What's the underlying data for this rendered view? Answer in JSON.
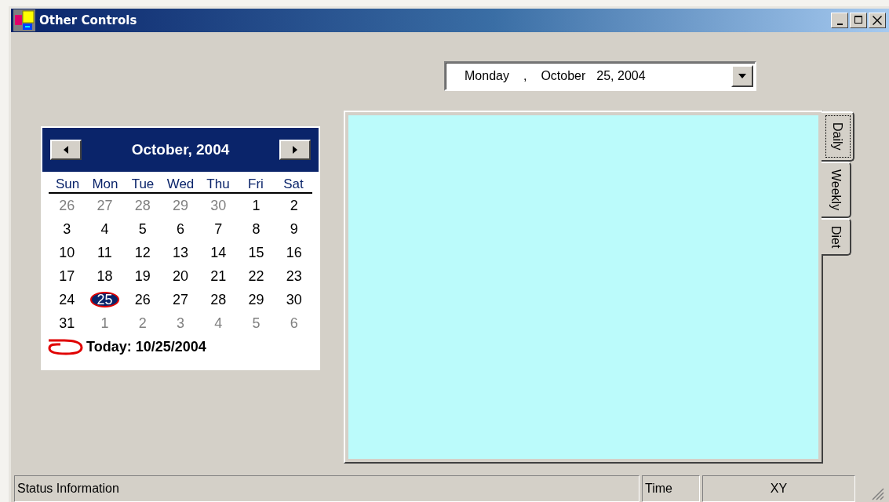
{
  "window": {
    "title": "Other Controls",
    "buttons": [
      {
        "kind": "minimize"
      },
      {
        "kind": "maximize"
      },
      {
        "kind": "close"
      }
    ]
  },
  "date_picker": {
    "segments": [
      "Monday",
      ",",
      "October",
      "25, 2004"
    ]
  },
  "calendar": {
    "title": "October, 2004",
    "weekdays": [
      "Sun",
      "Mon",
      "Tue",
      "Wed",
      "Thu",
      "Fri",
      "Sat"
    ],
    "weeks": [
      [
        {
          "text": "26",
          "other_month": true,
          "selected": false,
          "today": false
        },
        {
          "text": "27",
          "other_month": true,
          "selected": false,
          "today": false
        },
        {
          "text": "28",
          "other_month": true,
          "selected": false,
          "today": false
        },
        {
          "text": "29",
          "other_month": true,
          "selected": false,
          "today": false
        },
        {
          "text": "30",
          "other_month": true,
          "selected": false,
          "today": false
        },
        {
          "text": "1",
          "other_month": false,
          "selected": false,
          "today": false
        },
        {
          "text": "2",
          "other_month": false,
          "selected": false,
          "today": false
        }
      ],
      [
        {
          "text": "3",
          "other_month": false,
          "selected": false,
          "today": false
        },
        {
          "text": "4",
          "other_month": false,
          "selected": false,
          "today": false
        },
        {
          "text": "5",
          "other_month": false,
          "selected": false,
          "today": false
        },
        {
          "text": "6",
          "other_month": false,
          "selected": false,
          "today": false
        },
        {
          "text": "7",
          "other_month": false,
          "selected": false,
          "today": false
        },
        {
          "text": "8",
          "other_month": false,
          "selected": false,
          "today": false
        },
        {
          "text": "9",
          "other_month": false,
          "selected": false,
          "today": false
        }
      ],
      [
        {
          "text": "10",
          "other_month": false,
          "selected": false,
          "today": false
        },
        {
          "text": "11",
          "other_month": false,
          "selected": false,
          "today": false
        },
        {
          "text": "12",
          "other_month": false,
          "selected": false,
          "today": false
        },
        {
          "text": "13",
          "other_month": false,
          "selected": false,
          "today": false
        },
        {
          "text": "14",
          "other_month": false,
          "selected": false,
          "today": false
        },
        {
          "text": "15",
          "other_month": false,
          "selected": false,
          "today": false
        },
        {
          "text": "16",
          "other_month": false,
          "selected": false,
          "today": false
        }
      ],
      [
        {
          "text": "17",
          "other_month": false,
          "selected": false,
          "today": false
        },
        {
          "text": "18",
          "other_month": false,
          "selected": false,
          "today": false
        },
        {
          "text": "19",
          "other_month": false,
          "selected": false,
          "today": false
        },
        {
          "text": "20",
          "other_month": false,
          "selected": false,
          "today": false
        },
        {
          "text": "21",
          "other_month": false,
          "selected": false,
          "today": false
        },
        {
          "text": "22",
          "other_month": false,
          "selected": false,
          "today": false
        },
        {
          "text": "23",
          "other_month": false,
          "selected": false,
          "today": false
        }
      ],
      [
        {
          "text": "24",
          "other_month": false,
          "selected": false,
          "today": false
        },
        {
          "text": "25",
          "other_month": false,
          "selected": true,
          "today": true
        },
        {
          "text": "26",
          "other_month": false,
          "selected": false,
          "today": false
        },
        {
          "text": "27",
          "other_month": false,
          "selected": false,
          "today": false
        },
        {
          "text": "28",
          "other_month": false,
          "selected": false,
          "today": false
        },
        {
          "text": "29",
          "other_month": false,
          "selected": false,
          "today": false
        },
        {
          "text": "30",
          "other_month": false,
          "selected": false,
          "today": false
        }
      ],
      [
        {
          "text": "31",
          "other_month": false,
          "selected": false,
          "today": false
        },
        {
          "text": "1",
          "other_month": true,
          "selected": false,
          "today": false
        },
        {
          "text": "2",
          "other_month": true,
          "selected": false,
          "today": false
        },
        {
          "text": "3",
          "other_month": true,
          "selected": false,
          "today": false
        },
        {
          "text": "4",
          "other_month": true,
          "selected": false,
          "today": false
        },
        {
          "text": "5",
          "other_month": true,
          "selected": false,
          "today": false
        },
        {
          "text": "6",
          "other_month": true,
          "selected": false,
          "today": false
        }
      ]
    ],
    "today_label": "Today: 10/25/2004"
  },
  "tabs": [
    {
      "label": "Daily",
      "selected": true
    },
    {
      "label": "Weekly",
      "selected": false
    },
    {
      "label": "Diet",
      "selected": false
    }
  ],
  "status_bar": {
    "panels": [
      {
        "text": "Status Information",
        "kind": "left"
      },
      {
        "text": "Time",
        "kind": "left"
      },
      {
        "text": "XY",
        "kind": "center"
      }
    ]
  }
}
